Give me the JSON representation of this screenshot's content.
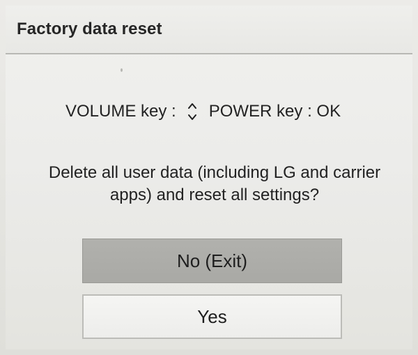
{
  "dialog": {
    "title": "Factory data reset",
    "key_hint": {
      "volume": "VOLUME key :",
      "power": "POWER key : OK",
      "arrow_icon": "up-down-arrows-icon"
    },
    "question": "Delete all user data (including LG and carrier apps) and reset all settings?",
    "buttons": {
      "no": "No (Exit)",
      "yes": "Yes"
    }
  },
  "colors": {
    "title_bar": "#e8e8e5",
    "selected_button": "#acaca8",
    "normal_button": "#efefed",
    "text": "#222222"
  }
}
